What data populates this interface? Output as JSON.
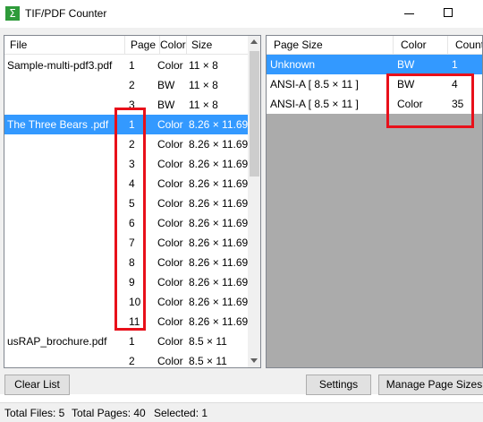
{
  "window": {
    "title": "TIF/PDF Counter",
    "icon_glyph": "Σ"
  },
  "file_list": {
    "columns": [
      "File",
      "Page",
      "Color",
      "Size"
    ],
    "rows": [
      {
        "file": "Sample-multi-pdf3.pdf",
        "page": "1",
        "color": "Color",
        "size": "11 × 8",
        "selected": false
      },
      {
        "file": "",
        "page": "2",
        "color": "BW",
        "size": "11 × 8",
        "selected": false
      },
      {
        "file": "",
        "page": "3",
        "color": "BW",
        "size": "11 × 8",
        "selected": false
      },
      {
        "file": "The Three Bears .pdf",
        "page": "1",
        "color": "Color",
        "size": "8.26 × 11.69",
        "selected": true
      },
      {
        "file": "",
        "page": "2",
        "color": "Color",
        "size": "8.26 × 11.69",
        "selected": false
      },
      {
        "file": "",
        "page": "3",
        "color": "Color",
        "size": "8.26 × 11.69",
        "selected": false
      },
      {
        "file": "",
        "page": "4",
        "color": "Color",
        "size": "8.26 × 11.69",
        "selected": false
      },
      {
        "file": "",
        "page": "5",
        "color": "Color",
        "size": "8.26 × 11.69",
        "selected": false
      },
      {
        "file": "",
        "page": "6",
        "color": "Color",
        "size": "8.26 × 11.69",
        "selected": false
      },
      {
        "file": "",
        "page": "7",
        "color": "Color",
        "size": "8.26 × 11.69",
        "selected": false
      },
      {
        "file": "",
        "page": "8",
        "color": "Color",
        "size": "8.26 × 11.69",
        "selected": false
      },
      {
        "file": "",
        "page": "9",
        "color": "Color",
        "size": "8.26 × 11.69",
        "selected": false
      },
      {
        "file": "",
        "page": "10",
        "color": "Color",
        "size": "8.26 × 11.69",
        "selected": false
      },
      {
        "file": "",
        "page": "11",
        "color": "Color",
        "size": "8.26 × 11.69",
        "selected": false
      },
      {
        "file": "usRAP_brochure.pdf",
        "page": "1",
        "color": "Color",
        "size": "8.5 × 11",
        "selected": false
      },
      {
        "file": "",
        "page": "2",
        "color": "Color",
        "size": "8.5 × 11",
        "selected": false
      }
    ]
  },
  "size_list": {
    "columns": [
      "Page Size",
      "Color",
      "Count"
    ],
    "rows": [
      {
        "size": "Unknown",
        "color": "BW",
        "count": "1",
        "selected": true
      },
      {
        "size": "ANSI-A [ 8.5 × 11 ]",
        "color": "BW",
        "count": "4",
        "selected": false
      },
      {
        "size": "ANSI-A [ 8.5 × 11 ]",
        "color": "Color",
        "count": "35",
        "selected": false
      }
    ]
  },
  "buttons": {
    "clear": "Clear List",
    "settings": "Settings",
    "manage": "Manage Page Sizes"
  },
  "status": {
    "total_files": "Total Files: 5",
    "total_pages": "Total Pages: 40",
    "selected": "Selected: 1"
  },
  "colors": {
    "selection": "#3399ff",
    "highlight": "#e8101a",
    "empty_list_bg": "#ababab"
  }
}
